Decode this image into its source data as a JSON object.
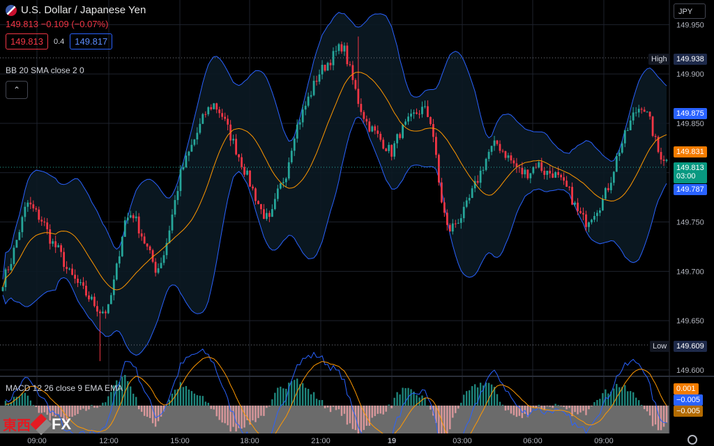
{
  "header": {
    "symbol_title": "U.S. Dollar / Japanese Yen",
    "quote_line": "149.813  −0.109  (−0.07%)",
    "sell_price": "149.813",
    "spread": "0.4",
    "buy_price": "149.817"
  },
  "indicators": {
    "bb_label": "BB 20 SMA close 2 0",
    "macd_label": "MACD 12 26 close 9 EMA EMA"
  },
  "currency_selector": "JPY",
  "price_scale": {
    "ticks": [
      "149.950",
      "149.900",
      "149.850",
      "149.800",
      "149.750",
      "149.700",
      "149.650",
      "149.600"
    ],
    "tick_values": [
      149.95,
      149.9,
      149.85,
      149.8,
      149.75,
      149.7,
      149.65,
      149.6
    ],
    "high_label": "High",
    "high_value": "149.938",
    "low_label": "Low",
    "low_value": "149.609",
    "upper_band": "149.875",
    "middle_band": "149.831",
    "last_price": "149.813",
    "countdown": "03:00",
    "lower_band": "149.787"
  },
  "macd_scale": {
    "histogram": "0.001",
    "macd": "−0.005",
    "signal": "−0.005"
  },
  "time_axis": {
    "labels": [
      "09:00",
      "12:00",
      "15:00",
      "18:00",
      "21:00",
      "19",
      "03:00",
      "06:00",
      "09:00"
    ]
  },
  "watermark": {
    "cn": "東西",
    "fx": "FX"
  },
  "colors": {
    "bull": "#26a69a",
    "bear": "#f23645",
    "band": "#2962ff",
    "basis": "#ff9800",
    "macd_line": "#2962ff",
    "signal_line": "#ff9800"
  },
  "chart_data": {
    "type": "candlestick",
    "ylim": [
      149.595,
      149.975
    ],
    "high": 149.938,
    "low": 149.609,
    "upper_band_last": 149.875,
    "basis_last": 149.831,
    "lower_band_last": 149.787,
    "last": 149.813,
    "closes": [
      149.69,
      149.71,
      149.74,
      149.77,
      149.76,
      149.75,
      149.73,
      149.72,
      149.7,
      149.69,
      149.68,
      149.67,
      149.66,
      149.66,
      149.7,
      149.75,
      149.76,
      149.74,
      149.72,
      149.7,
      149.72,
      149.76,
      149.8,
      149.82,
      149.84,
      149.86,
      149.87,
      149.86,
      149.84,
      149.82,
      149.8,
      149.78,
      149.76,
      149.75,
      149.78,
      149.8,
      149.84,
      149.86,
      149.88,
      149.9,
      149.91,
      149.92,
      149.93,
      149.9,
      149.87,
      149.85,
      149.84,
      149.83,
      149.82,
      149.84,
      149.85,
      149.86,
      149.865,
      149.85,
      149.78,
      149.74,
      149.75,
      149.76,
      149.78,
      149.8,
      149.82,
      149.83,
      149.82,
      149.81,
      149.8,
      149.8,
      149.81,
      149.8,
      149.8,
      149.79,
      149.78,
      149.76,
      149.75,
      149.76,
      149.77,
      149.79,
      149.82,
      149.84,
      149.86,
      149.87,
      149.85,
      149.82,
      149.813
    ],
    "macd_hist_last": 0.001,
    "macd_last": -0.005,
    "signal_last": -0.005
  }
}
